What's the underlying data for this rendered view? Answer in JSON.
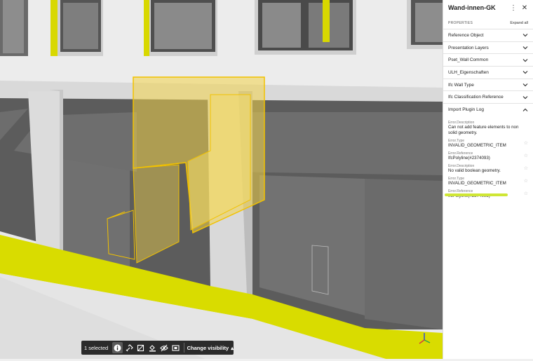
{
  "panel": {
    "title": "Wand-innen-GK",
    "properties_label": "PROPERTIES",
    "expand_all": "Expand all",
    "sections": [
      {
        "label": "Reference Object"
      },
      {
        "label": "Presentation Layers"
      },
      {
        "label": "Pset_Wall Common"
      },
      {
        "label": "ULH_Eigenschaften"
      },
      {
        "label": "Ifc Wall Type"
      },
      {
        "label": "Ifc Classification Reference"
      },
      {
        "label": "Import Plugin Log"
      }
    ],
    "log_entries": [
      {
        "key": "Error.Description",
        "value": "Can not add feature elements to non solid geometry."
      },
      {
        "key": "Error.Type",
        "value": "INVALID_GEOMETRIC_ITEM"
      },
      {
        "key": "Error.Reference",
        "value": "IfcPolyline(#2374093)"
      },
      {
        "key": "Error.Description",
        "value": "No valid boolean geometry."
      },
      {
        "key": "Error.Type",
        "value": "INVALID_GEOMETRIC_ITEM"
      },
      {
        "key": "Error.Reference",
        "value": "IfcPolyline(#2374093)"
      }
    ]
  },
  "toolbar": {
    "selected_label": "1 selected",
    "change_visibility_label": "Change visibility",
    "icons": [
      "info-icon",
      "link-icon",
      "section-box-icon",
      "paint-icon",
      "hide-icon",
      "isolate-icon"
    ]
  },
  "colors": {
    "highlight_yellow": "#f2d34a",
    "floor_yellow": "#d9dc00",
    "panel_highlight": "#cfe635",
    "toolbar_bg": "#2b2b2b"
  }
}
